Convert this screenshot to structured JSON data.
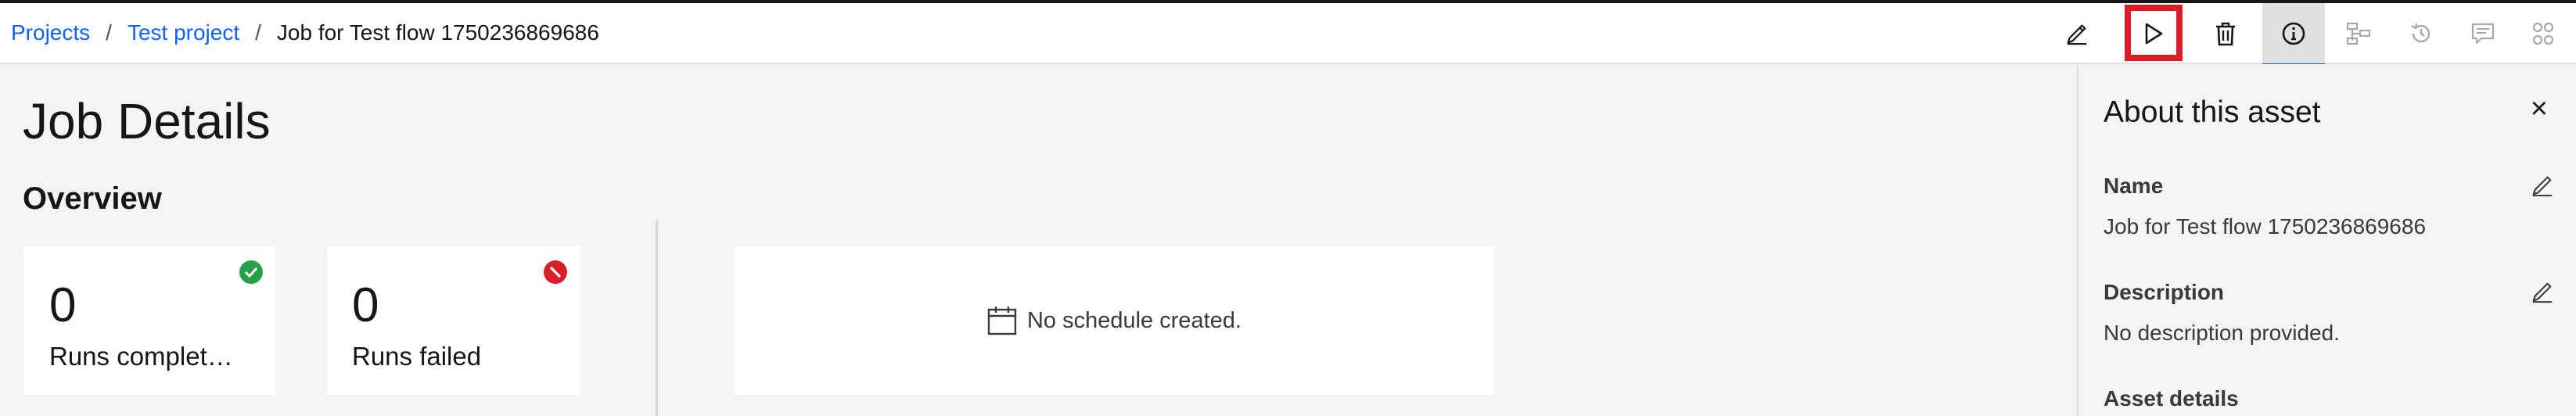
{
  "breadcrumb": {
    "items": [
      "Projects",
      "Test project"
    ],
    "separator": "/",
    "current": "Job for Test flow 1750236869686"
  },
  "toolbar": {
    "icons": [
      "edit-icon",
      "run-icon",
      "delete-icon",
      "info-icon",
      "lineage-icon",
      "history-icon",
      "comment-icon",
      "related-assets-icon"
    ],
    "active_tab": "info-icon",
    "highlight_color": "#da1e28"
  },
  "main": {
    "title": "Job Details",
    "overview_title": "Overview",
    "tiles": [
      {
        "value": "0",
        "label": "Runs complet…",
        "status_color": "#24a148"
      },
      {
        "value": "0",
        "label": "Runs failed",
        "status_color": "#da1e28"
      }
    ],
    "schedule_text": "No schedule created."
  },
  "panel": {
    "title": "About this asset",
    "close_label": "×",
    "name_label": "Name",
    "name_value": "Job for Test flow 1750236869686",
    "description_label": "Description",
    "description_value": "No description provided.",
    "asset_details_label": "Asset details"
  },
  "colors": {
    "link": "#0f62fe",
    "success": "#24a148",
    "error": "#da1e28",
    "active_tab_underline": "#0f62fe"
  }
}
